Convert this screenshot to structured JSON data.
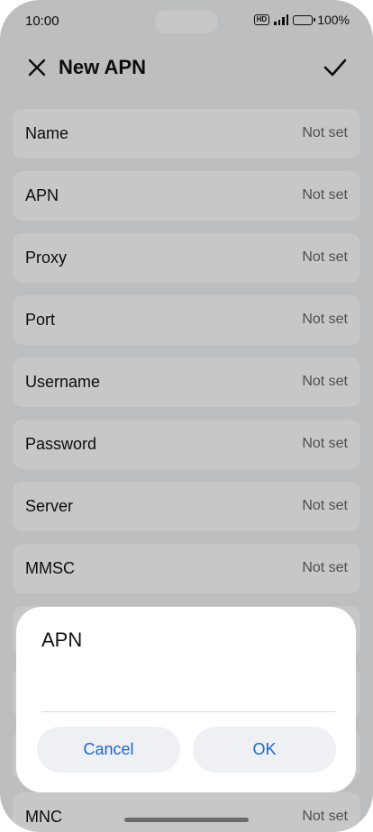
{
  "status_bar": {
    "time": "10:00",
    "hd_badge": "HD",
    "battery": "100%"
  },
  "header": {
    "title": "New APN",
    "close_icon": "close-icon",
    "confirm_icon": "check-icon"
  },
  "fields": [
    {
      "label": "Name",
      "value": "Not set"
    },
    {
      "label": "APN",
      "value": "Not set"
    },
    {
      "label": "Proxy",
      "value": "Not set"
    },
    {
      "label": "Port",
      "value": "Not set"
    },
    {
      "label": "Username",
      "value": "Not set"
    },
    {
      "label": "Password",
      "value": "Not set"
    },
    {
      "label": "Server",
      "value": "Not set"
    },
    {
      "label": "MMSC",
      "value": "Not set"
    },
    {
      "label": "",
      "value": ""
    },
    {
      "label": "",
      "value": ""
    },
    {
      "label": "",
      "value": ""
    },
    {
      "label": "MNC",
      "value": "Not set"
    }
  ],
  "dialog": {
    "title": "APN",
    "input_value": "",
    "cancel_label": "Cancel",
    "ok_label": "OK"
  },
  "colors": {
    "accent": "#1a66d6",
    "row_background": "#ffffff",
    "page_background": "#f3f4f6"
  }
}
